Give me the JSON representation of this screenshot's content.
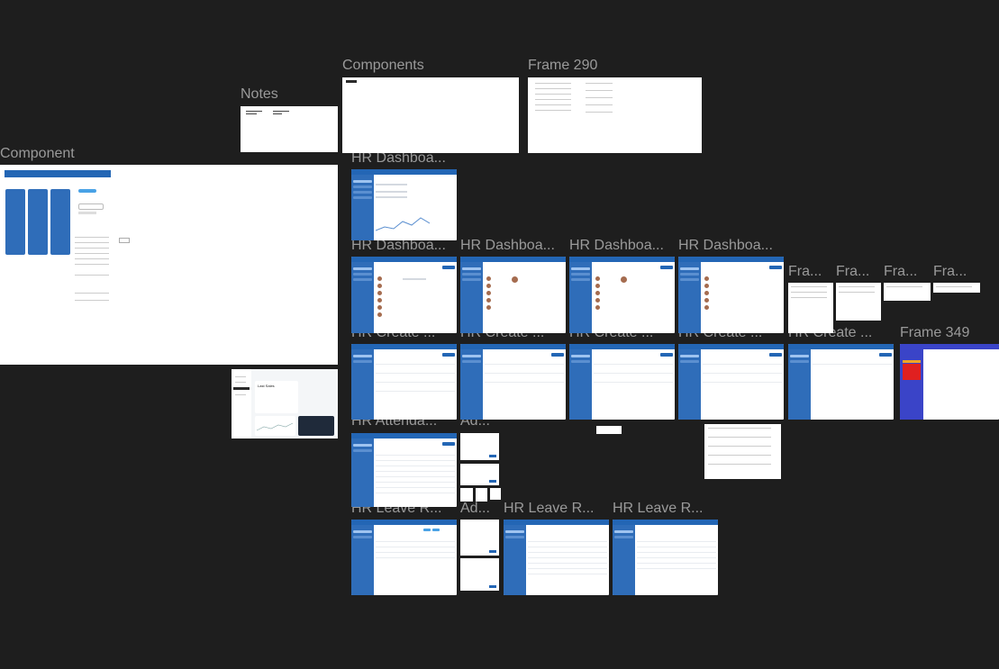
{
  "canvas": {
    "background": "#1e1e1e",
    "label_color": "#9a9a9a",
    "accent": "#2366b5"
  },
  "labels": {
    "component": "Component",
    "notes": "Notes",
    "components": "Components",
    "frame290": "Frame 290",
    "hr_dashboard_1": "HR Dashboa...",
    "hr_dashboard_2": "HR Dashboa...",
    "hr_dashboard_3": "HR Dashboa...",
    "hr_dashboard_4": "HR Dashboa...",
    "hr_dashboard_5": "HR Dashboa...",
    "fra_1": "Fra...",
    "fra_2": "Fra...",
    "fra_3": "Fra...",
    "fra_4": "Fra...",
    "hr_create_1": "HR Create ...",
    "hr_create_2": "HR Create ...",
    "hr_create_3": "HR Create ...",
    "hr_create_4": "HR Create ...",
    "hr_create_5": "HR Create ...",
    "frame349": "Frame 349",
    "hr_attendance": "HR Attenda...",
    "ad_1": "Ad...",
    "ad_2": "Ad...",
    "hr_leave_1": "HR Leave R...",
    "hr_leave_2": "HR Leave R...",
    "hr_leave_3": "HR Leave R..."
  },
  "dashboard_card": {
    "title": "Last Sales"
  }
}
